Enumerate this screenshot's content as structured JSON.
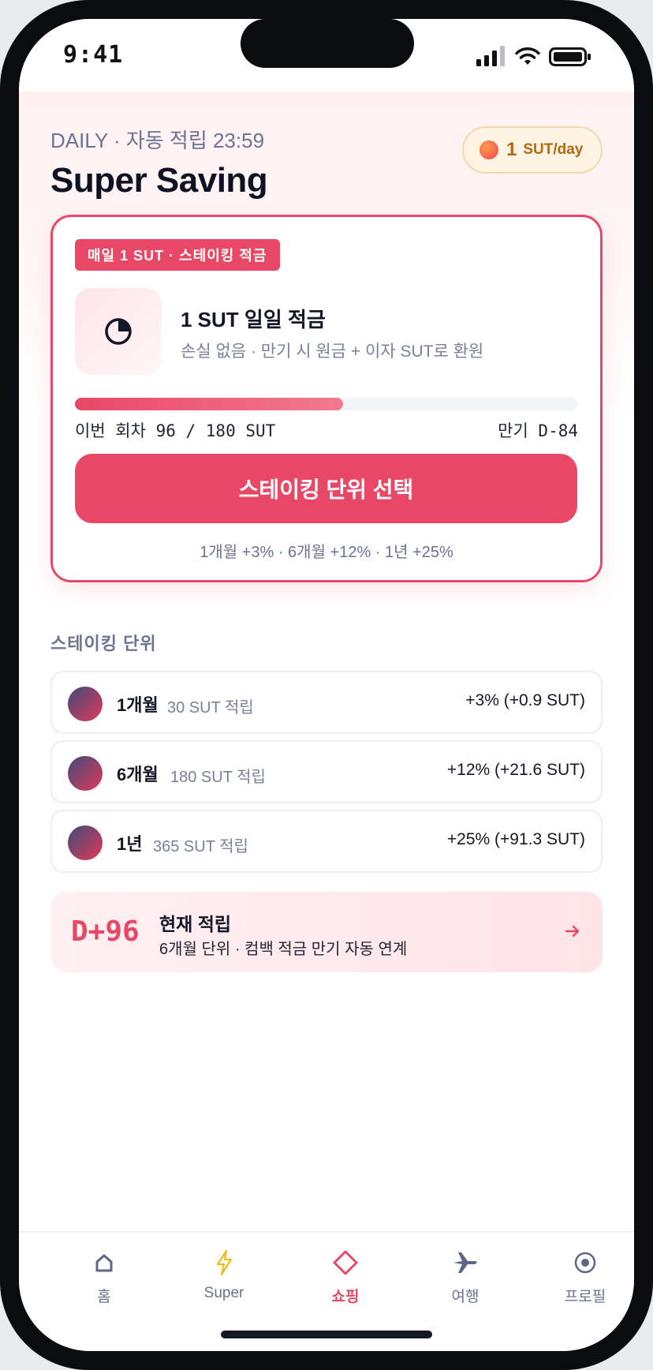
{
  "status_bar": {
    "time": "9:41"
  },
  "header": {
    "subtitle": "DAILY · 자동 적립 23:59",
    "title": "Super Saving",
    "rate_value": "1",
    "rate_unit": "SUT/day"
  },
  "plan_card": {
    "badge": "매일 1 SUT · 스테이킹 적금",
    "title": "1 SUT 일일 적금",
    "description": "손실 없음 · 만기 시 원금 + 이자 SUT로 환원",
    "progress_label": "이번 회차 96 / 180 SUT",
    "progress_fraction": 0.533,
    "maturity": "만기 D-84",
    "cta": "스테이킹 단위 선택",
    "rates_note": "1개월 +3% · 6개월 +12% · 1년 +25%"
  },
  "units_section": {
    "label": "스테이킹 단위",
    "items": [
      {
        "name": "1개월",
        "amount": "30 SUT 적립",
        "return": "+3% (+0.9 SUT)"
      },
      {
        "name": "6개월",
        "amount": "180 SUT 적립",
        "return": "+12% (+21.6 SUT)"
      },
      {
        "name": "1년",
        "amount": "365 SUT 적립",
        "return": "+25% (+91.3 SUT)"
      }
    ]
  },
  "current": {
    "days": "D+96",
    "title": "현재 적립",
    "description": "6개월 단위 · 컴백 적금 만기 자동 연계"
  },
  "tabbar": {
    "active": "shopping",
    "tabs": [
      {
        "label": "홈",
        "icon": "home-icon"
      },
      {
        "label": "Super",
        "icon": "lightning-icon"
      },
      {
        "label": "쇼핑",
        "icon": "diamond-icon"
      },
      {
        "label": "여행",
        "icon": "airplane-icon"
      },
      {
        "label": "프로필",
        "icon": "profile-icon"
      }
    ]
  },
  "colors": {
    "accent": "#e84865",
    "muted_text": "#6b7490",
    "rate_pill": "#fff3e3"
  }
}
